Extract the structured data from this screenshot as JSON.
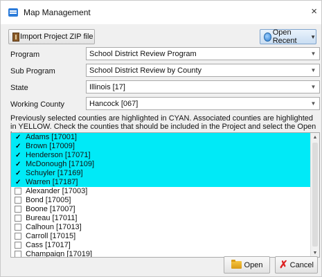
{
  "window": {
    "title": "Map Management",
    "close_glyph": "×"
  },
  "toolbar": {
    "import_label": "Import Project ZIP file",
    "import_icon": "zip-file-icon",
    "recent_label": "Open Recent",
    "recent_icon": "recent-icon"
  },
  "form": {
    "program_label": "Program",
    "program_value": "School District Review Program",
    "subprogram_label": "Sub Program",
    "subprogram_value": "School District Review by County",
    "state_label": "State",
    "state_value": "Illinois [17]",
    "county_label": "Working County",
    "county_value": "Hancock [067]"
  },
  "info_text": "Previously selected counties are highlighted in CYAN. Associated counties are highlighted in YELLOW. Check the counties that should be included in the Project and select the Open button.",
  "counties": [
    {
      "label": "Adams [17001]",
      "checked": true,
      "highlight": "cyan"
    },
    {
      "label": "Brown [17009]",
      "checked": true,
      "highlight": "cyan"
    },
    {
      "label": "Henderson [17071]",
      "checked": true,
      "highlight": "cyan"
    },
    {
      "label": "McDonough [17109]",
      "checked": true,
      "highlight": "cyan"
    },
    {
      "label": "Schuyler [17169]",
      "checked": true,
      "highlight": "cyan"
    },
    {
      "label": "Warren [17187]",
      "checked": true,
      "highlight": "cyan"
    },
    {
      "label": "Alexander [17003]",
      "checked": false,
      "highlight": "none"
    },
    {
      "label": "Bond [17005]",
      "checked": false,
      "highlight": "none"
    },
    {
      "label": "Boone [17007]",
      "checked": false,
      "highlight": "none"
    },
    {
      "label": "Bureau [17011]",
      "checked": false,
      "highlight": "none"
    },
    {
      "label": "Calhoun [17013]",
      "checked": false,
      "highlight": "none"
    },
    {
      "label": "Carroll [17015]",
      "checked": false,
      "highlight": "none"
    },
    {
      "label": "Cass [17017]",
      "checked": false,
      "highlight": "none"
    },
    {
      "label": "Champaign [17019]",
      "checked": false,
      "highlight": "none"
    }
  ],
  "buttons": {
    "open_label": "Open",
    "cancel_label": "Cancel"
  },
  "colors": {
    "cyan_highlight": "#00eaf7",
    "yellow_highlight": "#ffff00"
  }
}
